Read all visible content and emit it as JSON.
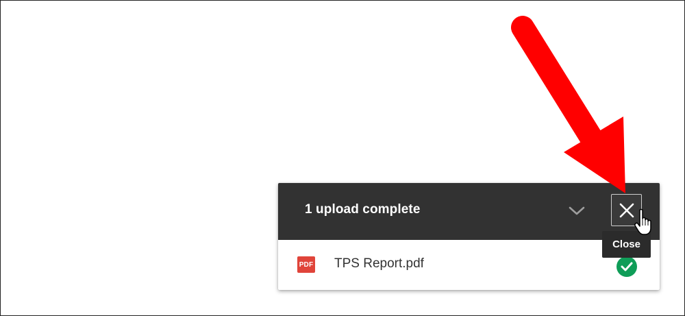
{
  "upload_panel": {
    "title": "1 upload complete",
    "tooltip": "Close",
    "files": [
      {
        "name": "TPS Report.pdf",
        "type_label": "PDF",
        "status": "complete"
      }
    ]
  },
  "icons": {
    "collapse": "chevron-down-icon",
    "close": "close-icon",
    "file": "pdf-file-icon",
    "status": "check-circle-icon",
    "cursor": "hand-pointer-icon",
    "annotation": "red-arrow"
  },
  "colors": {
    "header_bg": "#323232",
    "pdf_red": "#e0443a",
    "success_green": "#0f9d58",
    "annotation_red": "#ff0000"
  }
}
